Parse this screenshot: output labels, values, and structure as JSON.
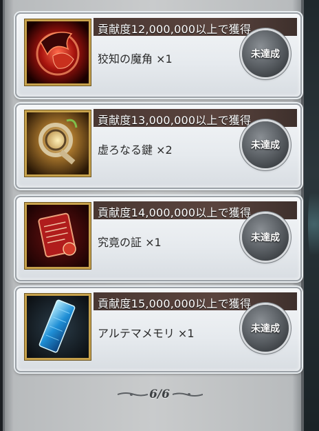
{
  "rewards": [
    {
      "header": "貢献度12,000,000以上で獲得",
      "item": "狡知の魔角 ×1",
      "status": "未達成",
      "icon": "demon-horn-icon"
    },
    {
      "header": "貢献度13,000,000以上で獲得",
      "item": "虚ろなる鍵 ×2",
      "status": "未達成",
      "icon": "hollow-key-icon"
    },
    {
      "header": "貢献度14,000,000以上で獲得",
      "item": "究竟の証 ×1",
      "status": "未達成",
      "icon": "scroll-seal-icon"
    },
    {
      "header": "貢献度15,000,000以上で獲得",
      "item": "アルテマメモリ ×1",
      "status": "未達成",
      "icon": "ultima-memory-icon"
    }
  ],
  "pager": {
    "text": "6/6"
  },
  "colors": {
    "header_bar": "#4a3833",
    "frame_gold": "#c7a24c",
    "status_button": "#5d6267"
  }
}
